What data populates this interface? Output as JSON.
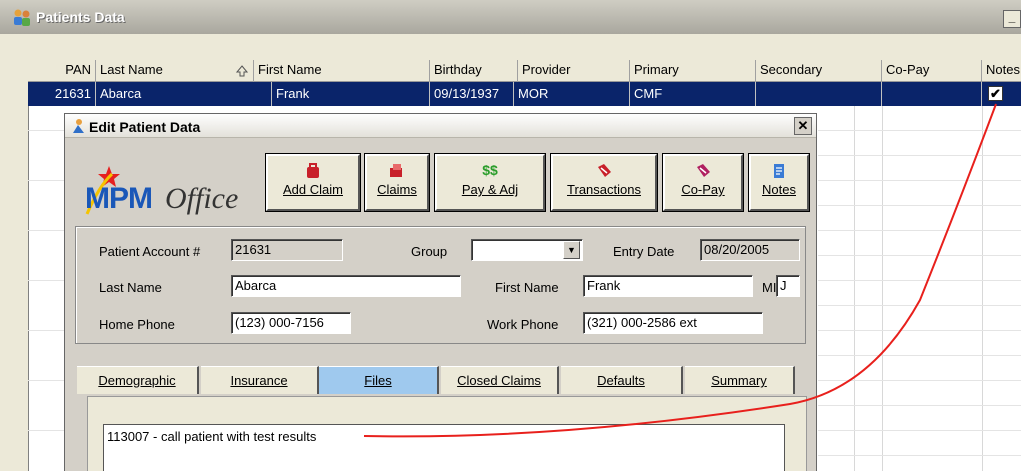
{
  "window": {
    "title": "Patients Data",
    "minimize_label": "_"
  },
  "grid": {
    "columns": [
      "PAN",
      "Last Name",
      "First Name",
      "Birthday",
      "Provider",
      "Primary",
      "Secondary",
      "Co-Pay",
      "Notes"
    ],
    "rows": [
      {
        "pan": "21631",
        "last_name": "Abarca",
        "first_name": "Frank",
        "birthday": "09/13/1937",
        "provider": "MOR",
        "primary": "CMF",
        "secondary": "",
        "copay": "",
        "notes_checked": true
      }
    ],
    "check_mark": "✔"
  },
  "dialog": {
    "title": "Edit Patient Data",
    "close_label": "✕",
    "logo": {
      "mpm": "MPM",
      "office": "Office"
    },
    "toolbar": [
      {
        "label": "Add Claim",
        "icon": "add-claim-icon"
      },
      {
        "label": "Claims",
        "icon": "claims-icon"
      },
      {
        "label": "Pay & Adj",
        "icon": "dollar-icon",
        "glyph": "$$"
      },
      {
        "label": "Transactions",
        "icon": "transactions-icon"
      },
      {
        "label": "Co-Pay",
        "icon": "copay-icon"
      },
      {
        "label": "Notes",
        "icon": "notes-icon"
      }
    ],
    "fields": {
      "account_label": "Patient Account #",
      "account_value": "21631",
      "group_label": "Group",
      "group_value": "",
      "entry_date_label": "Entry Date",
      "entry_date_value": "08/20/2005",
      "last_name_label": "Last Name",
      "last_name_value": "Abarca",
      "first_name_label": "First Name",
      "first_name_value": "Frank",
      "mi_label": "MI",
      "mi_value": "J",
      "home_phone_label": "Home Phone",
      "home_phone_value": "(123) 000-7156",
      "work_phone_label": "Work Phone",
      "work_phone_value": "(321) 000-2586 ext"
    },
    "tabs": [
      "Demographic",
      "Insurance",
      "Files",
      "Closed Claims",
      "Defaults",
      "Summary"
    ],
    "active_tab": "Files",
    "note_text": "113007 - call patient with test results"
  },
  "colors": {
    "selection": "#0a246a",
    "active_tab": "#9fc9ee",
    "annotation": "#e8201c",
    "logo_blue": "#1a57b8"
  }
}
